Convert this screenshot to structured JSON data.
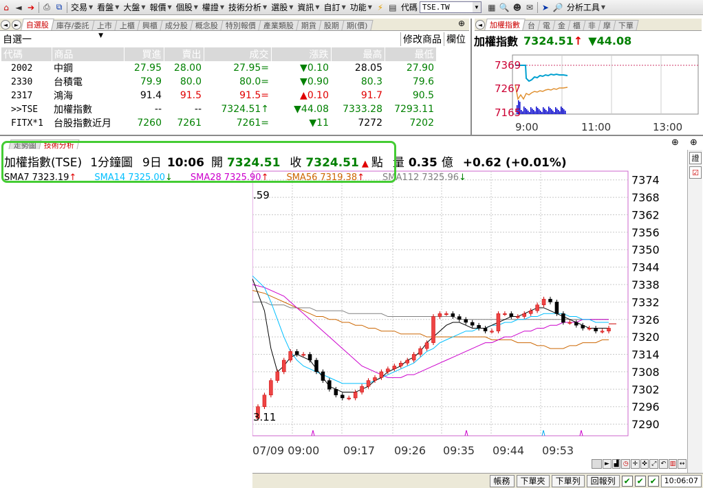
{
  "toolbar": {
    "menus": [
      "交易",
      "看盤",
      "大盤",
      "報價",
      "個股",
      "權證",
      "技術分析",
      "選股",
      "資訊",
      "自訂",
      "功能"
    ],
    "code_label": "代碼",
    "code_value": "TSE.TW",
    "tools_label": "分析工具"
  },
  "watch_tabs": [
    "自選股",
    "庫存/委託",
    "上市",
    "上櫃",
    "興櫃",
    "成分股",
    "概念股",
    "特別報價",
    "產業類股",
    "期貨",
    "股期",
    "期(價)"
  ],
  "watch_active": 0,
  "index_tabs": [
    "加權指數",
    "台",
    "電",
    "金",
    "櫃",
    "非",
    "摩",
    "下單"
  ],
  "index_active": 0,
  "watchlist": {
    "selector": "自選一",
    "buttons": [
      "修改商品",
      "欄位"
    ],
    "columns": [
      "代碼",
      "商品",
      "買進",
      "賣出",
      "成交",
      "漲跌",
      "最高",
      "最低"
    ],
    "rows": [
      {
        "code": "2002",
        "name": "中鋼",
        "bid": "27.95",
        "ask": "28.00",
        "last": "27.95=",
        "chg": "▼0.10",
        "high": "28.05",
        "low": "27.90",
        "bc": "g",
        "ac": "g",
        "lc": "g",
        "cc": "g",
        "hc": "",
        "lwc": "g"
      },
      {
        "code": "2330",
        "name": "台積電",
        "bid": "79.9",
        "ask": "80.0",
        "last": "80.0=",
        "chg": "▼0.90",
        "high": "80.3",
        "low": "79.6",
        "bc": "g",
        "ac": "g",
        "lc": "g",
        "cc": "g",
        "hc": "g",
        "lwc": "g"
      },
      {
        "code": "2317",
        "name": "鴻海",
        "bid": "91.4",
        "ask": "91.5",
        "last": "91.5=",
        "chg": "▲0.10",
        "high": "91.7",
        "low": "90.5",
        "bc": "",
        "ac": "r",
        "lc": "r",
        "cc": "r",
        "hc": "r",
        "lwc": "g"
      },
      {
        "code": ">>TSE",
        "name": "加權指數",
        "bid": "--",
        "ask": "--",
        "last": "7324.51↑",
        "chg": "▼44.08",
        "high": "7333.28",
        "low": "7293.11",
        "bc": "",
        "ac": "",
        "lc": "g",
        "cc": "g",
        "hc": "g",
        "lwc": "g"
      },
      {
        "code": "FITX*1",
        "name": "台股指數近月",
        "bid": "7260",
        "ask": "7261",
        "last": "7261=",
        "chg": "▼11",
        "high": "7272",
        "low": "7202",
        "bc": "g",
        "ac": "g",
        "lc": "g",
        "cc": "g",
        "hc": "",
        "lwc": "g"
      }
    ]
  },
  "index_pane": {
    "title": "加權指數",
    "value": "7324.51",
    "up_arrow": "↑",
    "change": "▼44.08",
    "y_ticks": [
      "7369",
      "7267",
      "7165"
    ],
    "x_ticks": [
      "9:00",
      "11:00",
      "13:00"
    ]
  },
  "chart_tabs": [
    "走勢圖",
    "技術分析"
  ],
  "chart_header": {
    "name": "加權指數(TSE)",
    "period": "1分鐘圖",
    "date": "9日",
    "time": "10:06",
    "open_label": "開",
    "open": "7324.51",
    "close_label": "收",
    "close": "7324.51",
    "unit": "點",
    "vol_label": "量",
    "volume": "0.35",
    "vol_unit": "億",
    "change": "+0.62 (+0.01%)"
  },
  "sma": [
    {
      "label": "SMA7",
      "value": "7323.19",
      "color": "#000000",
      "arrow": "↑"
    },
    {
      "label": "SMA14",
      "value": "7325.00",
      "color": "#00bfff",
      "arrow": "↓"
    },
    {
      "label": "SMA28",
      "value": "7325.90",
      "color": "#cc00cc",
      "arrow": "↑"
    },
    {
      "label": "SMA56",
      "value": "7319.38",
      "color": "#cc6600",
      "arrow": "↑"
    },
    {
      "label": "SMA112",
      "value": "7325.96",
      "color": "#808080",
      "arrow": "↓"
    }
  ],
  "chart_annotations": {
    "high_label": ".59",
    "low_label": "3.11"
  },
  "chart_data": {
    "type": "candlestick",
    "y_ticks": [
      7374,
      7368,
      7362,
      7356,
      7350,
      7344,
      7338,
      7332,
      7326,
      7320,
      7314,
      7308,
      7302,
      7296,
      7290
    ],
    "x_ticks": [
      "07/09 09:00",
      "09:17",
      "09:26",
      "09:35",
      "09:44",
      "09:53"
    ],
    "close": [
      7296,
      7300,
      7305,
      7308,
      7312,
      7315,
      7314,
      7314,
      7312,
      7308,
      7305,
      7302,
      7300,
      7299,
      7299,
      7301,
      7303,
      7305,
      7306,
      7308,
      7309,
      7310,
      7311,
      7312,
      7314,
      7316,
      7318,
      7327,
      7328,
      7328,
      7327,
      7326,
      7325,
      7324,
      7323,
      7322,
      7322,
      7328,
      7328,
      7327,
      7327,
      7328,
      7329,
      7331,
      7333,
      7332,
      7328,
      7325,
      7325,
      7324,
      7323,
      7323,
      7322,
      7322,
      7323
    ],
    "sma7": [
      7340,
      7329,
      7316,
      7308,
      7310,
      7313,
      7314,
      7313,
      7312,
      7309,
      7306,
      7303,
      7302,
      7301,
      7301,
      7301,
      7302,
      7303,
      7305,
      7306,
      7308,
      7309,
      7310,
      7312,
      7313,
      7315,
      7318,
      7320,
      7322,
      7324,
      7325,
      7325,
      7324,
      7323,
      7323,
      7323,
      7324,
      7325,
      7326,
      7327,
      7327,
      7328,
      7329,
      7330,
      7330,
      7329,
      7328,
      7327,
      7326,
      7325,
      7324,
      7323,
      7323,
      7323,
      7323
    ],
    "sma14": [
      7341,
      7337,
      7332,
      7326,
      7320,
      7315,
      7312,
      7310,
      7309,
      7308,
      7307,
      7306,
      7305,
      7304,
      7304,
      7304,
      7304,
      7304,
      7305,
      7306,
      7307,
      7308,
      7309,
      7310,
      7311,
      7313,
      7315,
      7316,
      7318,
      7319,
      7320,
      7321,
      7322,
      7322,
      7323,
      7323,
      7324,
      7324,
      7325,
      7325,
      7326,
      7326,
      7327,
      7327,
      7328,
      7328,
      7328,
      7328,
      7327,
      7327,
      7326,
      7326,
      7325,
      7325,
      7325
    ],
    "sma28": [
      7338,
      7337,
      7336,
      7335,
      7334,
      7332,
      7330,
      7328,
      7326,
      7324,
      7322,
      7320,
      7318,
      7316,
      7314,
      7312,
      7310,
      7309,
      7308,
      7307,
      7306,
      7306,
      7306,
      7307,
      7307,
      7308,
      7309,
      7310,
      7311,
      7312,
      7313,
      7314,
      7315,
      7316,
      7317,
      7318,
      7318,
      7319,
      7320,
      7320,
      7321,
      7322,
      7322,
      7323,
      7323,
      7324,
      7324,
      7325,
      7325,
      7325,
      7326,
      7326,
      7326,
      7326,
      7326
    ],
    "sma56": [
      7336,
      7335,
      7334,
      7333,
      7332,
      7331,
      7330,
      7329,
      7328,
      7327,
      7327,
      7326,
      7326,
      7325,
      7325,
      7324,
      7324,
      7323,
      7323,
      7322,
      7322,
      7322,
      7321,
      7321,
      7321,
      7321,
      7320,
      7320,
      7320,
      7320,
      7320,
      7320,
      7320,
      7320,
      7320,
      7320,
      7319,
      7319,
      7319,
      7319,
      7318,
      7318,
      7318,
      7317,
      7317,
      7316,
      7316,
      7316,
      7317,
      7317,
      7318,
      7318,
      7318,
      7319,
      7319
    ],
    "sma112": [
      7332,
      7332,
      7331,
      7331,
      7331,
      7330,
      7330,
      7330,
      7330,
      7329,
      7329,
      7329,
      7329,
      7329,
      7328,
      7328,
      7328,
      7328,
      7328,
      7328,
      7327,
      7327,
      7327,
      7327,
      7327,
      7327,
      7327,
      7327,
      7327,
      7327,
      7327,
      7326,
      7326,
      7326,
      7326,
      7326,
      7326,
      7326,
      7326,
      7326,
      7326,
      7326,
      7326,
      7326,
      7326,
      7326,
      7326,
      7326,
      7326,
      7326,
      7326,
      7326,
      7326,
      7326,
      7326
    ]
  },
  "status_bar": {
    "buttons": [
      "帳務",
      "下單夾",
      "下單列",
      "回報列"
    ],
    "clock": "10:06:07"
  },
  "side_tools": [
    "證"
  ],
  "colors": {
    "up": "#e00000",
    "down": "#008000",
    "highlight": "#44cc33",
    "grid": "#c8c8c8",
    "chart_border": "#cc66cc"
  }
}
